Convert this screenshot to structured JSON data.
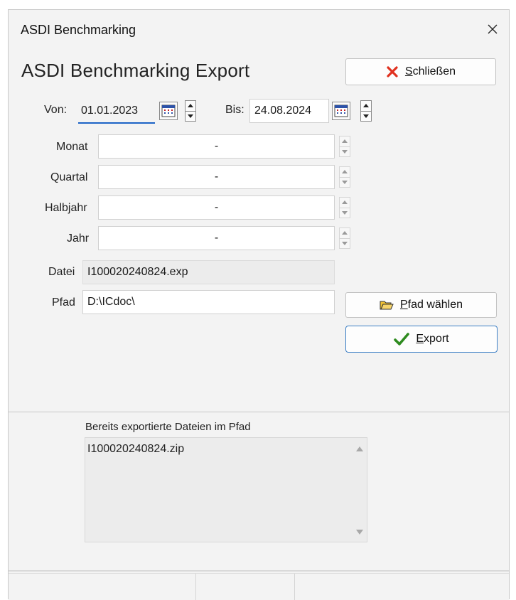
{
  "window": {
    "title": "ASDI Benchmarking"
  },
  "heading": "ASDI Benchmarking Export",
  "buttons": {
    "close_label": "Schließen",
    "choose_path_label": "Pfad wählen",
    "export_label": "Export"
  },
  "dates": {
    "from_label": "Von:",
    "from_value": "01.01.2023",
    "to_label": "Bis:",
    "to_value": "24.08.2024"
  },
  "periods": [
    {
      "label": "Monat",
      "value": "-"
    },
    {
      "label": "Quartal",
      "value": "-"
    },
    {
      "label": "Halbjahr",
      "value": "-"
    },
    {
      "label": "Jahr",
      "value": "-"
    }
  ],
  "file": {
    "label": "Datei",
    "value": "I100020240824.exp"
  },
  "path": {
    "label": "Pfad",
    "value": "D:\\ICdoc\\"
  },
  "exported": {
    "title": "Bereits exportierte Dateien im Pfad",
    "items": [
      "I100020240824.zip"
    ]
  },
  "icons": {
    "close": "close-icon",
    "close_button": "red-x-icon",
    "calendar": "calendar-icon",
    "folder": "folder-open-icon",
    "check": "checkmark-icon"
  },
  "colors": {
    "close_x": "#e0301e",
    "check": "#2e8b1f",
    "folder": "#f1c232",
    "focus": "#1b63c6"
  }
}
